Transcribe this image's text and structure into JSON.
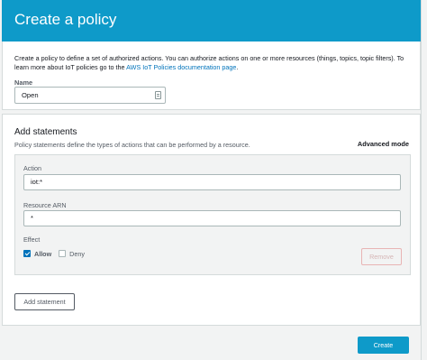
{
  "header": {
    "title": "Create a policy"
  },
  "intro": {
    "text": "Create a policy to define a set of authorized actions. You can authorize actions on one or more resources (things, topics, topic filters). To learn more about IoT policies go to the ",
    "link": "AWS IoT Policies documentation page",
    "suffix": "."
  },
  "name_field": {
    "label": "Name",
    "value": "Open"
  },
  "statements": {
    "title": "Add statements",
    "subtitle": "Policy statements define the types of actions that can be performed by a resource.",
    "advanced_mode": "Advanced mode",
    "statement": {
      "action_label": "Action",
      "action_value": "iot:*",
      "resource_label": "Resource ARN",
      "resource_value": "*",
      "effect_label": "Effect",
      "allow_label": "Allow",
      "allow_checked": true,
      "deny_label": "Deny",
      "deny_checked": false,
      "remove_label": "Remove"
    },
    "add_statement_label": "Add statement"
  },
  "footer": {
    "create_label": "Create"
  },
  "colors": {
    "accent": "#0e9ac9",
    "link": "#0073bb"
  }
}
